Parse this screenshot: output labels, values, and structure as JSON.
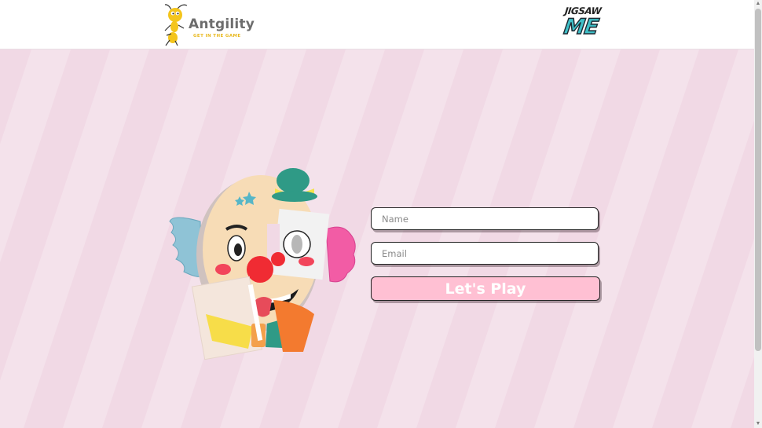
{
  "header": {
    "brand": {
      "name": "Antgility",
      "tagline": "GET IN THE GAME",
      "icon": "ant-mascot-icon"
    },
    "game_logo": {
      "top": "JIGSAW",
      "bottom": "ME"
    }
  },
  "form": {
    "name_placeholder": "Name",
    "email_placeholder": "Email",
    "submit_label": "Let's Play"
  },
  "illustration": {
    "subject": "clown-jigsaw-puzzle"
  },
  "colors": {
    "background": "#f1d9e5",
    "stripe": "#f6e6ee",
    "button": "#ffc0d3",
    "brand_yellow": "#e8b81c",
    "logo_teal": "#3fc0c8"
  }
}
